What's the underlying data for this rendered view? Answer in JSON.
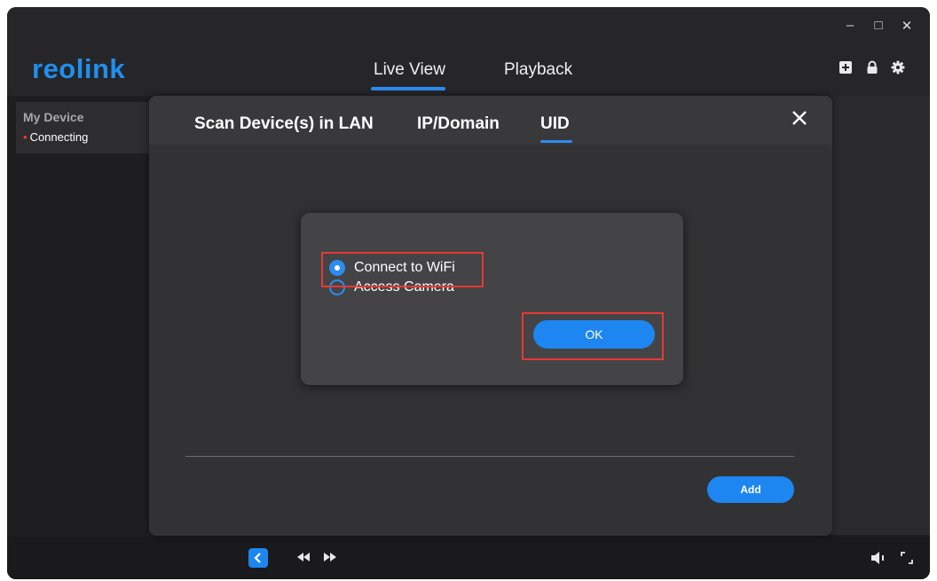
{
  "app": {
    "logo": "reolink",
    "window_controls": {
      "minimize": "–",
      "maximize": "□",
      "close": "✕"
    },
    "nav": {
      "tabs": [
        "Live View",
        "Playback"
      ],
      "active": "Live View"
    },
    "toolbar_icons": [
      "add-icon",
      "lock-icon",
      "gear-icon"
    ],
    "accent_color": "#2d8cf0"
  },
  "sidebar": {
    "device_title": "My Device",
    "device_status": "Connecting",
    "status_color": "#ff3b30"
  },
  "modal": {
    "tabs": [
      "Scan Device(s) in LAN",
      "IP/Domain",
      "UID"
    ],
    "active_tab": "UID",
    "add_button": "Add"
  },
  "dialog": {
    "options": [
      {
        "label": "Connect to WiFi",
        "selected": true
      },
      {
        "label": "Access Camera",
        "selected": false
      }
    ],
    "ok_button": "OK"
  },
  "bottombar": {
    "icons": [
      "chevron-left-icon",
      "rewind-icon",
      "fast-forward-icon",
      "volume-icon",
      "fullscreen-icon"
    ]
  }
}
